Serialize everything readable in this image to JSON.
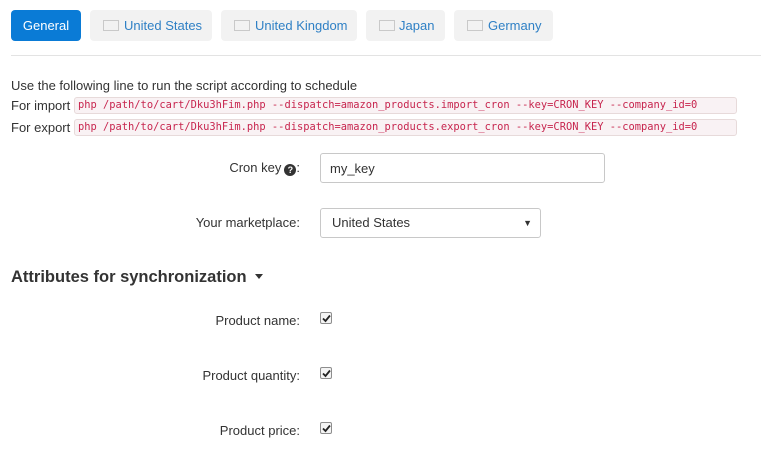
{
  "tabs": [
    {
      "label": "General",
      "active": true,
      "flag": null
    },
    {
      "label": "United States",
      "active": false,
      "flag": "us-flag-icon"
    },
    {
      "label": "United Kingdom",
      "active": false,
      "flag": "uk-flag-icon"
    },
    {
      "label": "Japan",
      "active": false,
      "flag": "japan-flag-icon"
    },
    {
      "label": "Germany",
      "active": false,
      "flag": "germany-flag-icon"
    }
  ],
  "cron": {
    "intro": "Use the following line to run the script according to schedule",
    "import_label": "For import",
    "import_command": "php /path/to/cart/Dku3hFim.php --dispatch=amazon_products.import_cron --key=CRON_KEY --company_id=0",
    "export_label": "For export",
    "export_command": "php /path/to/cart/Dku3hFim.php --dispatch=amazon_products.export_cron --key=CRON_KEY --company_id=0"
  },
  "form": {
    "cron_key_label": "Cron key",
    "cron_key_value": "my_key",
    "marketplace_label": "Your marketplace:",
    "marketplace_value": "United States"
  },
  "attributes": {
    "title": "Attributes for synchronization",
    "items": [
      {
        "label": "Product name:",
        "checked": true
      },
      {
        "label": "Product quantity:",
        "checked": true
      },
      {
        "label": "Product price:",
        "checked": true
      }
    ]
  },
  "colors": {
    "accent": "#0a7bd6",
    "link": "#2f80c5",
    "code_text": "#c7254e",
    "code_bg": "#f9f2f4"
  }
}
